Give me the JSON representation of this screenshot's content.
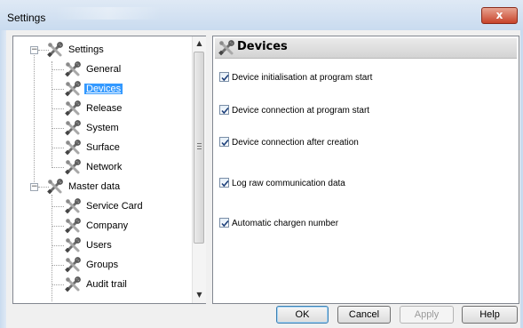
{
  "window": {
    "title": "Settings",
    "close_glyph": "x"
  },
  "tree": {
    "settings": {
      "label": "Settings",
      "expander": "−",
      "icon": "tools-icon"
    },
    "settings_children": [
      {
        "label": "General"
      },
      {
        "label": "Devices"
      },
      {
        "label": "Release"
      },
      {
        "label": "System"
      },
      {
        "label": "Surface"
      },
      {
        "label": "Network"
      }
    ],
    "master": {
      "label": "Master data",
      "expander": "−",
      "icon": "tools-icon"
    },
    "master_children": [
      {
        "label": "Service Card"
      },
      {
        "label": "Company"
      },
      {
        "label": "Users"
      },
      {
        "label": "Groups"
      },
      {
        "label": "Audit trail"
      }
    ],
    "selected": "Devices",
    "scroll_up": "▲",
    "scroll_down": "▼"
  },
  "panel": {
    "title": "Devices",
    "options": [
      {
        "label": "Device initialisation at program start",
        "checked": true
      },
      {
        "label": "Device connection at program start",
        "checked": true
      },
      {
        "label": "Device connection after creation",
        "checked": true
      },
      {
        "label": "Log raw communication data",
        "checked": true
      },
      {
        "label": "Automatic chargen number",
        "checked": true
      }
    ]
  },
  "buttons": {
    "ok": "OK",
    "cancel": "Cancel",
    "apply": "Apply",
    "help": "Help"
  },
  "colors": {
    "selection": "#3399ff",
    "title_bar": "#c9dbef",
    "close": "#c7432a"
  }
}
